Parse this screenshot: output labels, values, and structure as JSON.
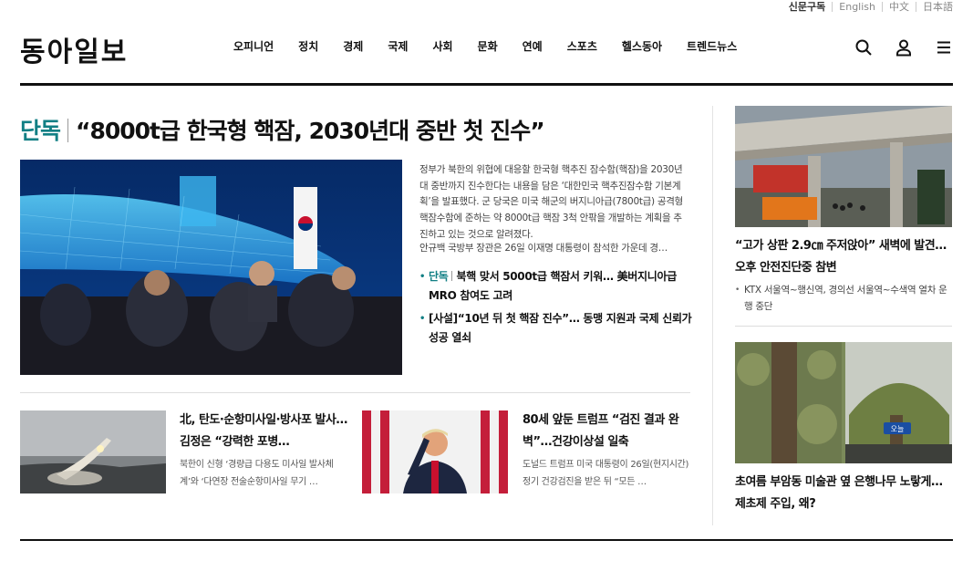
{
  "util_links": [
    "신문구독",
    "English",
    "中文",
    "日本語"
  ],
  "logo": "동아일보",
  "nav": [
    "오피니언",
    "정치",
    "경제",
    "국제",
    "사회",
    "문화",
    "연예",
    "스포츠",
    "헬스동아",
    "트렌드뉴스"
  ],
  "icons": [
    "search-icon",
    "user-icon",
    "menu-icon"
  ],
  "headline": {
    "label": "단독",
    "title": "“8000t급 한국형 핵잠, 2030년대 중반 첫 진수”",
    "desc": "정부가 북한의 위협에 대응할 한국형 핵추진 잠수함(핵잠)을 2030년대 중반까지 진수한다는 내용을 담은 ‘대한민국 핵추진잠수함 기본계획’을 발표했다. 군 당국은 미국 해군의 버지니아급(7800t급) 공격형 핵잠수함에 준하는 약 8000t급 핵잠 3척 안팎을 개발하는 계획을 추진하고 있는 것으로 알려졌다.",
    "desc2": "안규백 국방부 장관은 26일 이재명 대통령이 참석한 가운데 경…",
    "related": [
      {
        "label": "단독",
        "text": "북핵 맞서 5000t급 핵잠서 키워… 美버지니아급 MRO 참여도 고려"
      },
      {
        "label": "",
        "text": "[사설]“10년 뒤 첫 핵잠 진수”… 동맹 지원과 국제 신뢰가 성공 열쇠"
      }
    ]
  },
  "cards": [
    {
      "title": "北, 탄도·순항미사일·방사포 발사…김정은 “강력한 포병…",
      "desc": "북한이 신형 ‘경량급 다용도 미사일 발사체계’와 ‘다연장 전술순항미사일 무기 …"
    },
    {
      "title": "80세 앞둔 트럼프 “검진 결과 완벽”…건강이상설 일축",
      "desc": "도널드 트럼프 미국 대통령이 26일(현지시간) 정기 건강검진을 받은 뒤 “모든 …"
    }
  ],
  "side": [
    {
      "title": "“고가 상판 2.9㎝ 주저앉아” 새벽에 발견… 오후 안전진단중 참변",
      "sub": "KTX 서울역~행신역, 경의선 서울역~수색역 열차 운행 중단"
    },
    {
      "title": "초여름 부암동 미술관 옆 은행나무 노랗게…제초제 주입, 왜?",
      "sub": "",
      "badge": "오늘"
    }
  ]
}
